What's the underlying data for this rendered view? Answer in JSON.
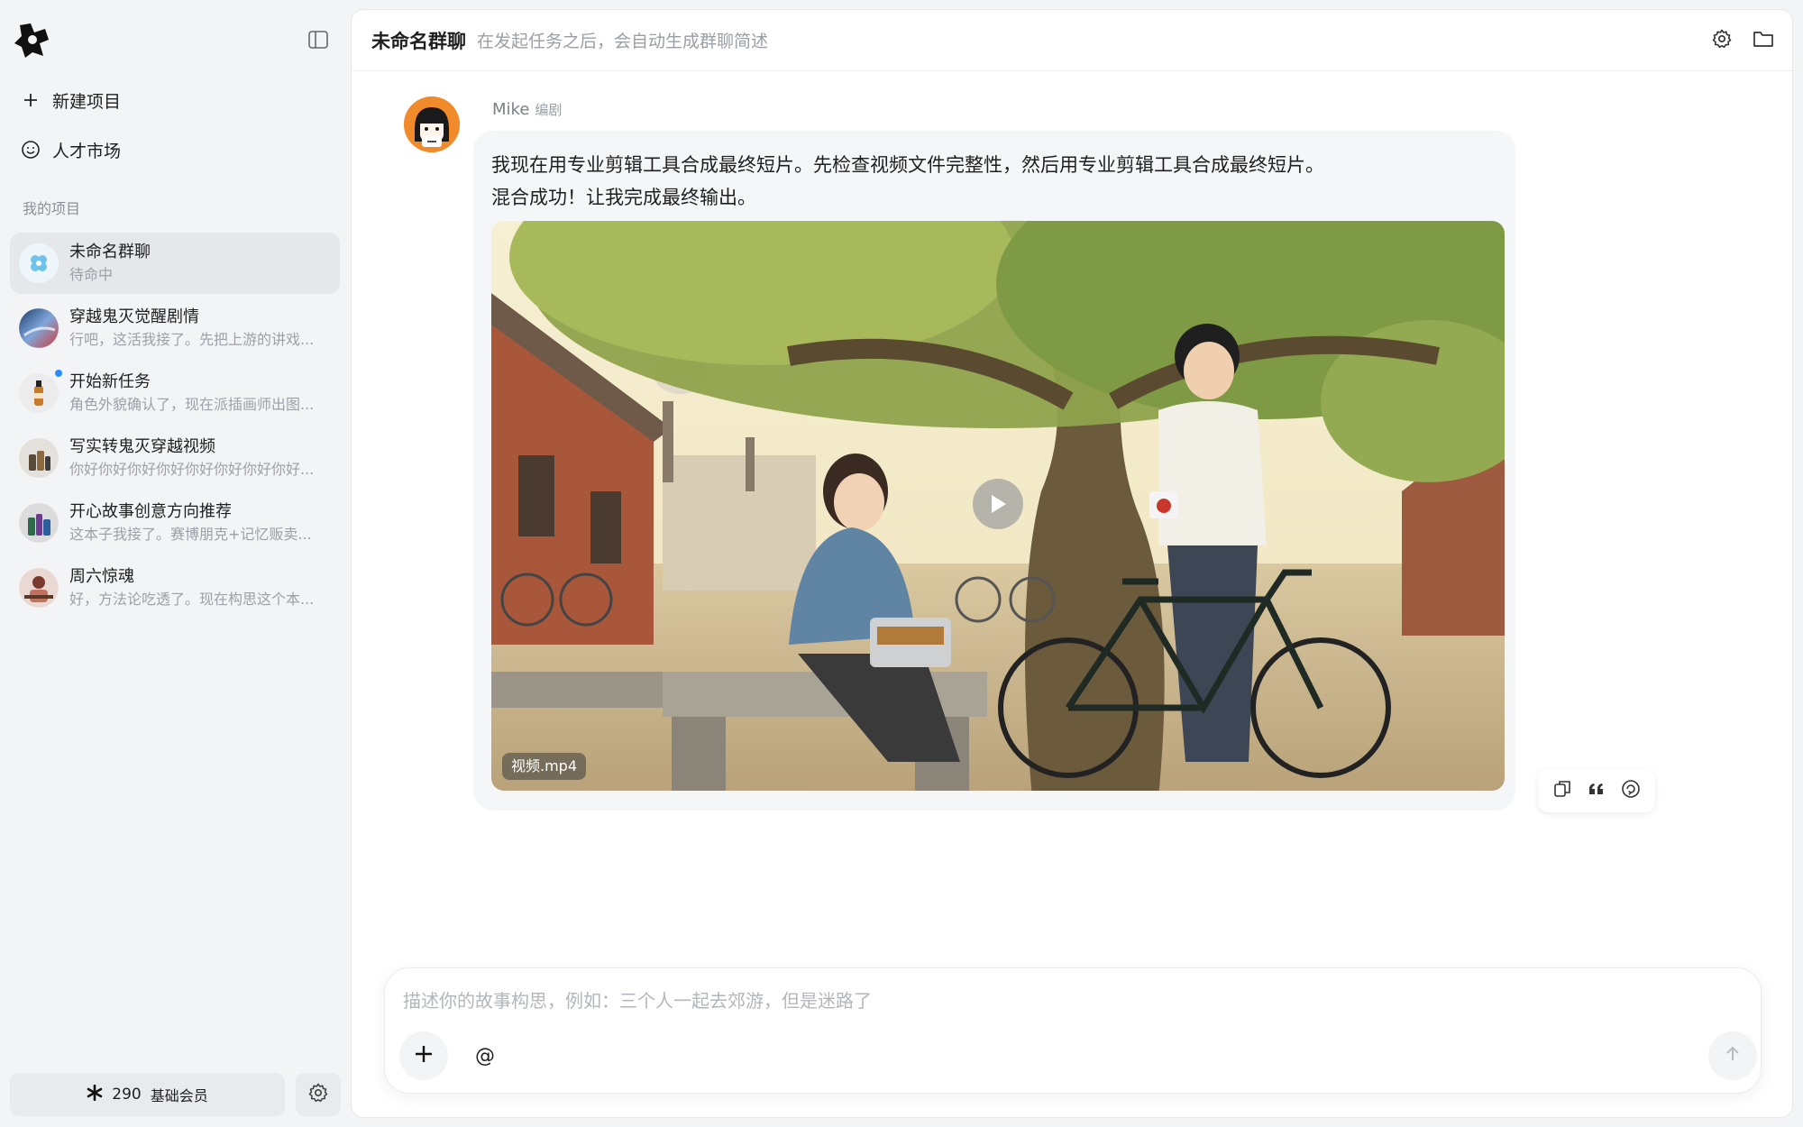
{
  "sidebar": {
    "new_project_label": "新建项目",
    "talent_market_label": "人才市场",
    "section_label": "我的项目",
    "projects": [
      {
        "title": "未命名群聊",
        "subtitle": "待命中"
      },
      {
        "title": "穿越鬼灭觉醒剧情",
        "subtitle": "行吧，这活我接了。先把上游的讲戏..."
      },
      {
        "title": "开始新任务",
        "subtitle": "角色外貌确认了，现在派插画师出图..."
      },
      {
        "title": "写实转鬼灭穿越视频",
        "subtitle": "你好你好你好你好你好你好你好你好..."
      },
      {
        "title": "开心故事创意方向推荐",
        "subtitle": "这本子我接了。赛博朋克+记忆贩卖..."
      },
      {
        "title": "周六惊魂",
        "subtitle": "好，方法论吃透了。现在构思这个本..."
      }
    ],
    "credits": "290",
    "membership": "基础会员"
  },
  "header": {
    "title": "未命名群聊",
    "subtitle": "在发起任务之后，会自动生成群聊简述"
  },
  "message": {
    "sender": "Mike",
    "role": "编剧",
    "line1": "我现在用专业剪辑工具合成最终短片。先检查视频文件完整性，然后用专业剪辑工具合成最终短片。",
    "line2": "混合成功！让我完成最终输出。",
    "video_filename": "视频.mp4"
  },
  "composer": {
    "placeholder": "描述你的故事构思，例如：三个人一起去郊游，但是迷路了",
    "mention_symbol": "@"
  },
  "icons": {
    "logo": "app-logo",
    "collapse": "sidebar-toggle-icon",
    "settings": "gear-icon",
    "folder": "folder-icon",
    "copy": "copy-icon",
    "quote": "quote-icon",
    "refresh": "regenerate-icon"
  },
  "colors": {
    "accent_unread": "#2b8cff",
    "avatar_bg": "#f08a2a"
  }
}
